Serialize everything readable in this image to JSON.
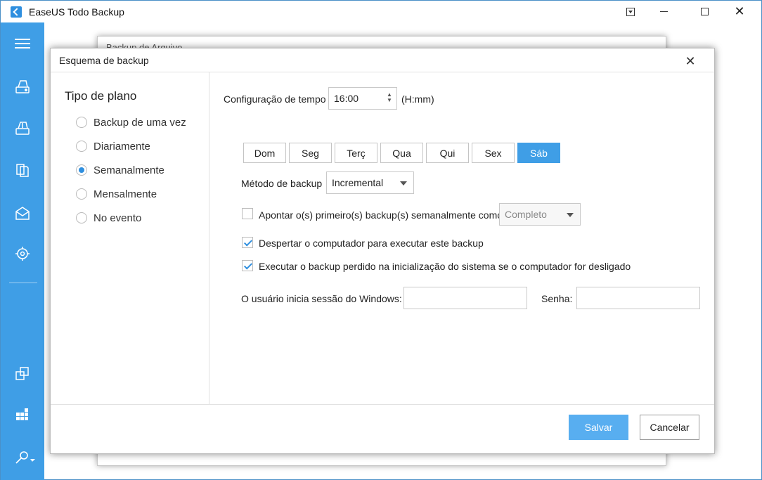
{
  "app": {
    "title": "EaseUS Todo Backup"
  },
  "background_window": {
    "title": "Backup de Arquivo"
  },
  "dialog": {
    "title": "Esquema de backup",
    "plan_type": {
      "heading": "Tipo de plano",
      "options": [
        {
          "label": "Backup de uma vez",
          "checked": false
        },
        {
          "label": "Diariamente",
          "checked": false
        },
        {
          "label": "Semanalmente",
          "checked": true
        },
        {
          "label": "Mensalmente",
          "checked": false
        },
        {
          "label": "No evento",
          "checked": false
        }
      ]
    },
    "time_config": {
      "label": "Configuração de tempo",
      "value": "16:00",
      "format": "(H:mm)"
    },
    "days": [
      {
        "label": "Dom",
        "selected": false
      },
      {
        "label": "Seg",
        "selected": false
      },
      {
        "label": "Terç",
        "selected": false
      },
      {
        "label": "Qua",
        "selected": false
      },
      {
        "label": "Qui",
        "selected": false
      },
      {
        "label": "Sex",
        "selected": false
      },
      {
        "label": "Sáb",
        "selected": true
      }
    ],
    "backup_method": {
      "label": "Método de backup",
      "value": "Incremental"
    },
    "first_backup": {
      "label": "Apontar o(s) primeiro(s) backup(s) semanalmente como",
      "checked": false,
      "value": "Completo"
    },
    "wake_computer": {
      "label": "Despertar o computador para executar este backup",
      "checked": true
    },
    "run_missed": {
      "label": "Executar o backup perdido na inicialização do sistema se o computador for desligado",
      "checked": true
    },
    "windows_user": {
      "label": "O usuário inicia sessão do Windows:",
      "value": ""
    },
    "password": {
      "label": "Senha:",
      "value": ""
    },
    "buttons": {
      "save": "Salvar",
      "cancel": "Cancelar"
    }
  },
  "colors": {
    "accent": "#3f9ee6",
    "save_button": "#58aef0"
  },
  "sidebar_icons": [
    "menu-icon",
    "disk-backup-icon",
    "partition-backup-icon",
    "file-backup-icon",
    "mail-backup-icon",
    "smart-backup-icon",
    "clone-icon",
    "tools-grid-icon",
    "wrench-icon"
  ]
}
